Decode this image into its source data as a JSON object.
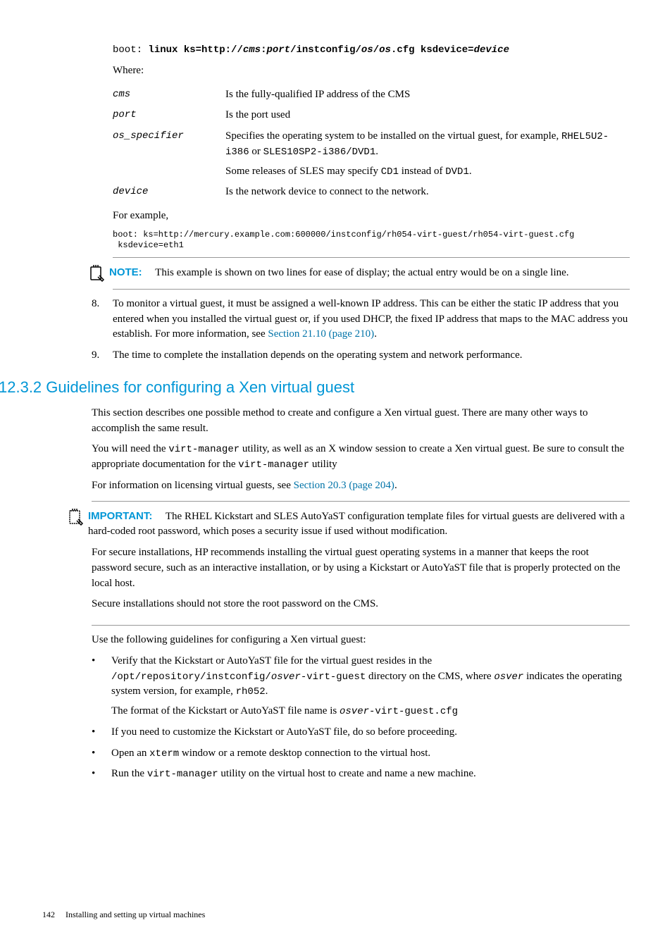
{
  "boot_line": {
    "prefix": "boot: ",
    "cmd": "linux ks=http://",
    "p1": "cms",
    "colon": ":",
    "p2": "port",
    "seg1": "/instconfig/",
    "p3": "os",
    "slash": "/",
    "p4": "os",
    "seg2": ".cfg ksdevice=",
    "p5": "device"
  },
  "where_label": "Where:",
  "definitions": {
    "cms": {
      "term": "cms",
      "def": "Is the fully-qualified IP address of the CMS"
    },
    "port": {
      "term": "port",
      "def": "Is the port used"
    },
    "os_specifier": {
      "term": "os_specifier",
      "def1a": "Specifies the operating system to be installed on the virtual guest, for example, ",
      "code1": "RHEL5U2-i386",
      "or": " or ",
      "code2": "SLES10SP2-i386/DVD1",
      "dot": ".",
      "def2a": "Some releases of SLES may specify ",
      "code3": "CD1",
      "def2b": " instead of ",
      "code4": "DVD1",
      "dot2": "."
    },
    "device": {
      "term": "device",
      "def": "Is the network device to connect to the network."
    }
  },
  "for_example": "For example,",
  "example_code": "boot: ks=http://mercury.example.com:600000/instconfig/rh054-virt-guest/rh054-virt-guest.cfg\n ksdevice=eth1",
  "note": {
    "label": "NOTE:",
    "text": "This example is shown on two lines for ease of display; the actual entry would be on a single line."
  },
  "list": {
    "item8": {
      "num": "8.",
      "text_a": "To monitor a virtual guest, it must be assigned a well-known IP address. This can be either the static IP address that you entered when you installed the virtual guest or, if you used DHCP, the fixed IP address that maps to the MAC address you establish. For more information, see ",
      "link": "Section 21.10 (page 210)",
      "dot": "."
    },
    "item9": {
      "num": "9.",
      "text": "The time to complete the installation depends on the operating system and network performance."
    }
  },
  "heading": "12.3.2 Guidelines for configuring a Xen virtual guest",
  "body": {
    "p1": "This section describes one possible method to create and configure a Xen virtual guest. There are many other ways to accomplish the same result.",
    "p2a": "You will need the ",
    "p2code1": "virt-manager",
    "p2b": " utility, as well as an X window session to create a Xen virtual guest. Be sure to consult the appropriate documentation for the ",
    "p2code2": "virt-manager",
    "p2c": " utility",
    "p3a": "For information on licensing virtual guests, see ",
    "p3link": "Section 20.3 (page 204)",
    "p3dot": "."
  },
  "important": {
    "label": "IMPORTANT:",
    "p1": "The RHEL Kickstart and SLES AutoYaST configuration template files for virtual guests are delivered with a hard-coded root password, which poses a security issue if used without modification.",
    "p2": "For secure installations, HP recommends installing the virtual guest operating systems in a manner that keeps the root password secure, such as an interactive installation, or by using a Kickstart or AutoYaST file that is properly protected on the local host.",
    "p3": "Secure installations should not store the root password on the CMS."
  },
  "guidelines_intro": "Use the following guidelines for configuring a Xen virtual guest:",
  "bullets": {
    "b1": {
      "a": "Verify that the Kickstart or AutoYaST file for the virtual guest resides in the ",
      "code1": "/opt/repository/instconfig/",
      "codeitalic": "osver",
      "code2": "-virt-guest",
      "b": " directory on the CMS, where ",
      "codeitalic2": "osver",
      "c": " indicates the operating system version, for example, ",
      "code3": "rh052",
      "dot": ".",
      "p2a": "The format of the Kickstart or AutoYaST file name is ",
      "p2codeitalic": "osver",
      "p2code": "-virt-guest.cfg"
    },
    "b2": "If you need to customize the Kickstart or AutoYaST file, do so before proceeding.",
    "b3a": "Open an ",
    "b3code": "xterm",
    "b3b": " window or a remote desktop connection to the virtual host.",
    "b4a": "Run the ",
    "b4code": "virt-manager",
    "b4b": " utility on the virtual host to create and name a new machine."
  },
  "footer": {
    "page": "142",
    "text": "Installing and setting up virtual machines"
  }
}
